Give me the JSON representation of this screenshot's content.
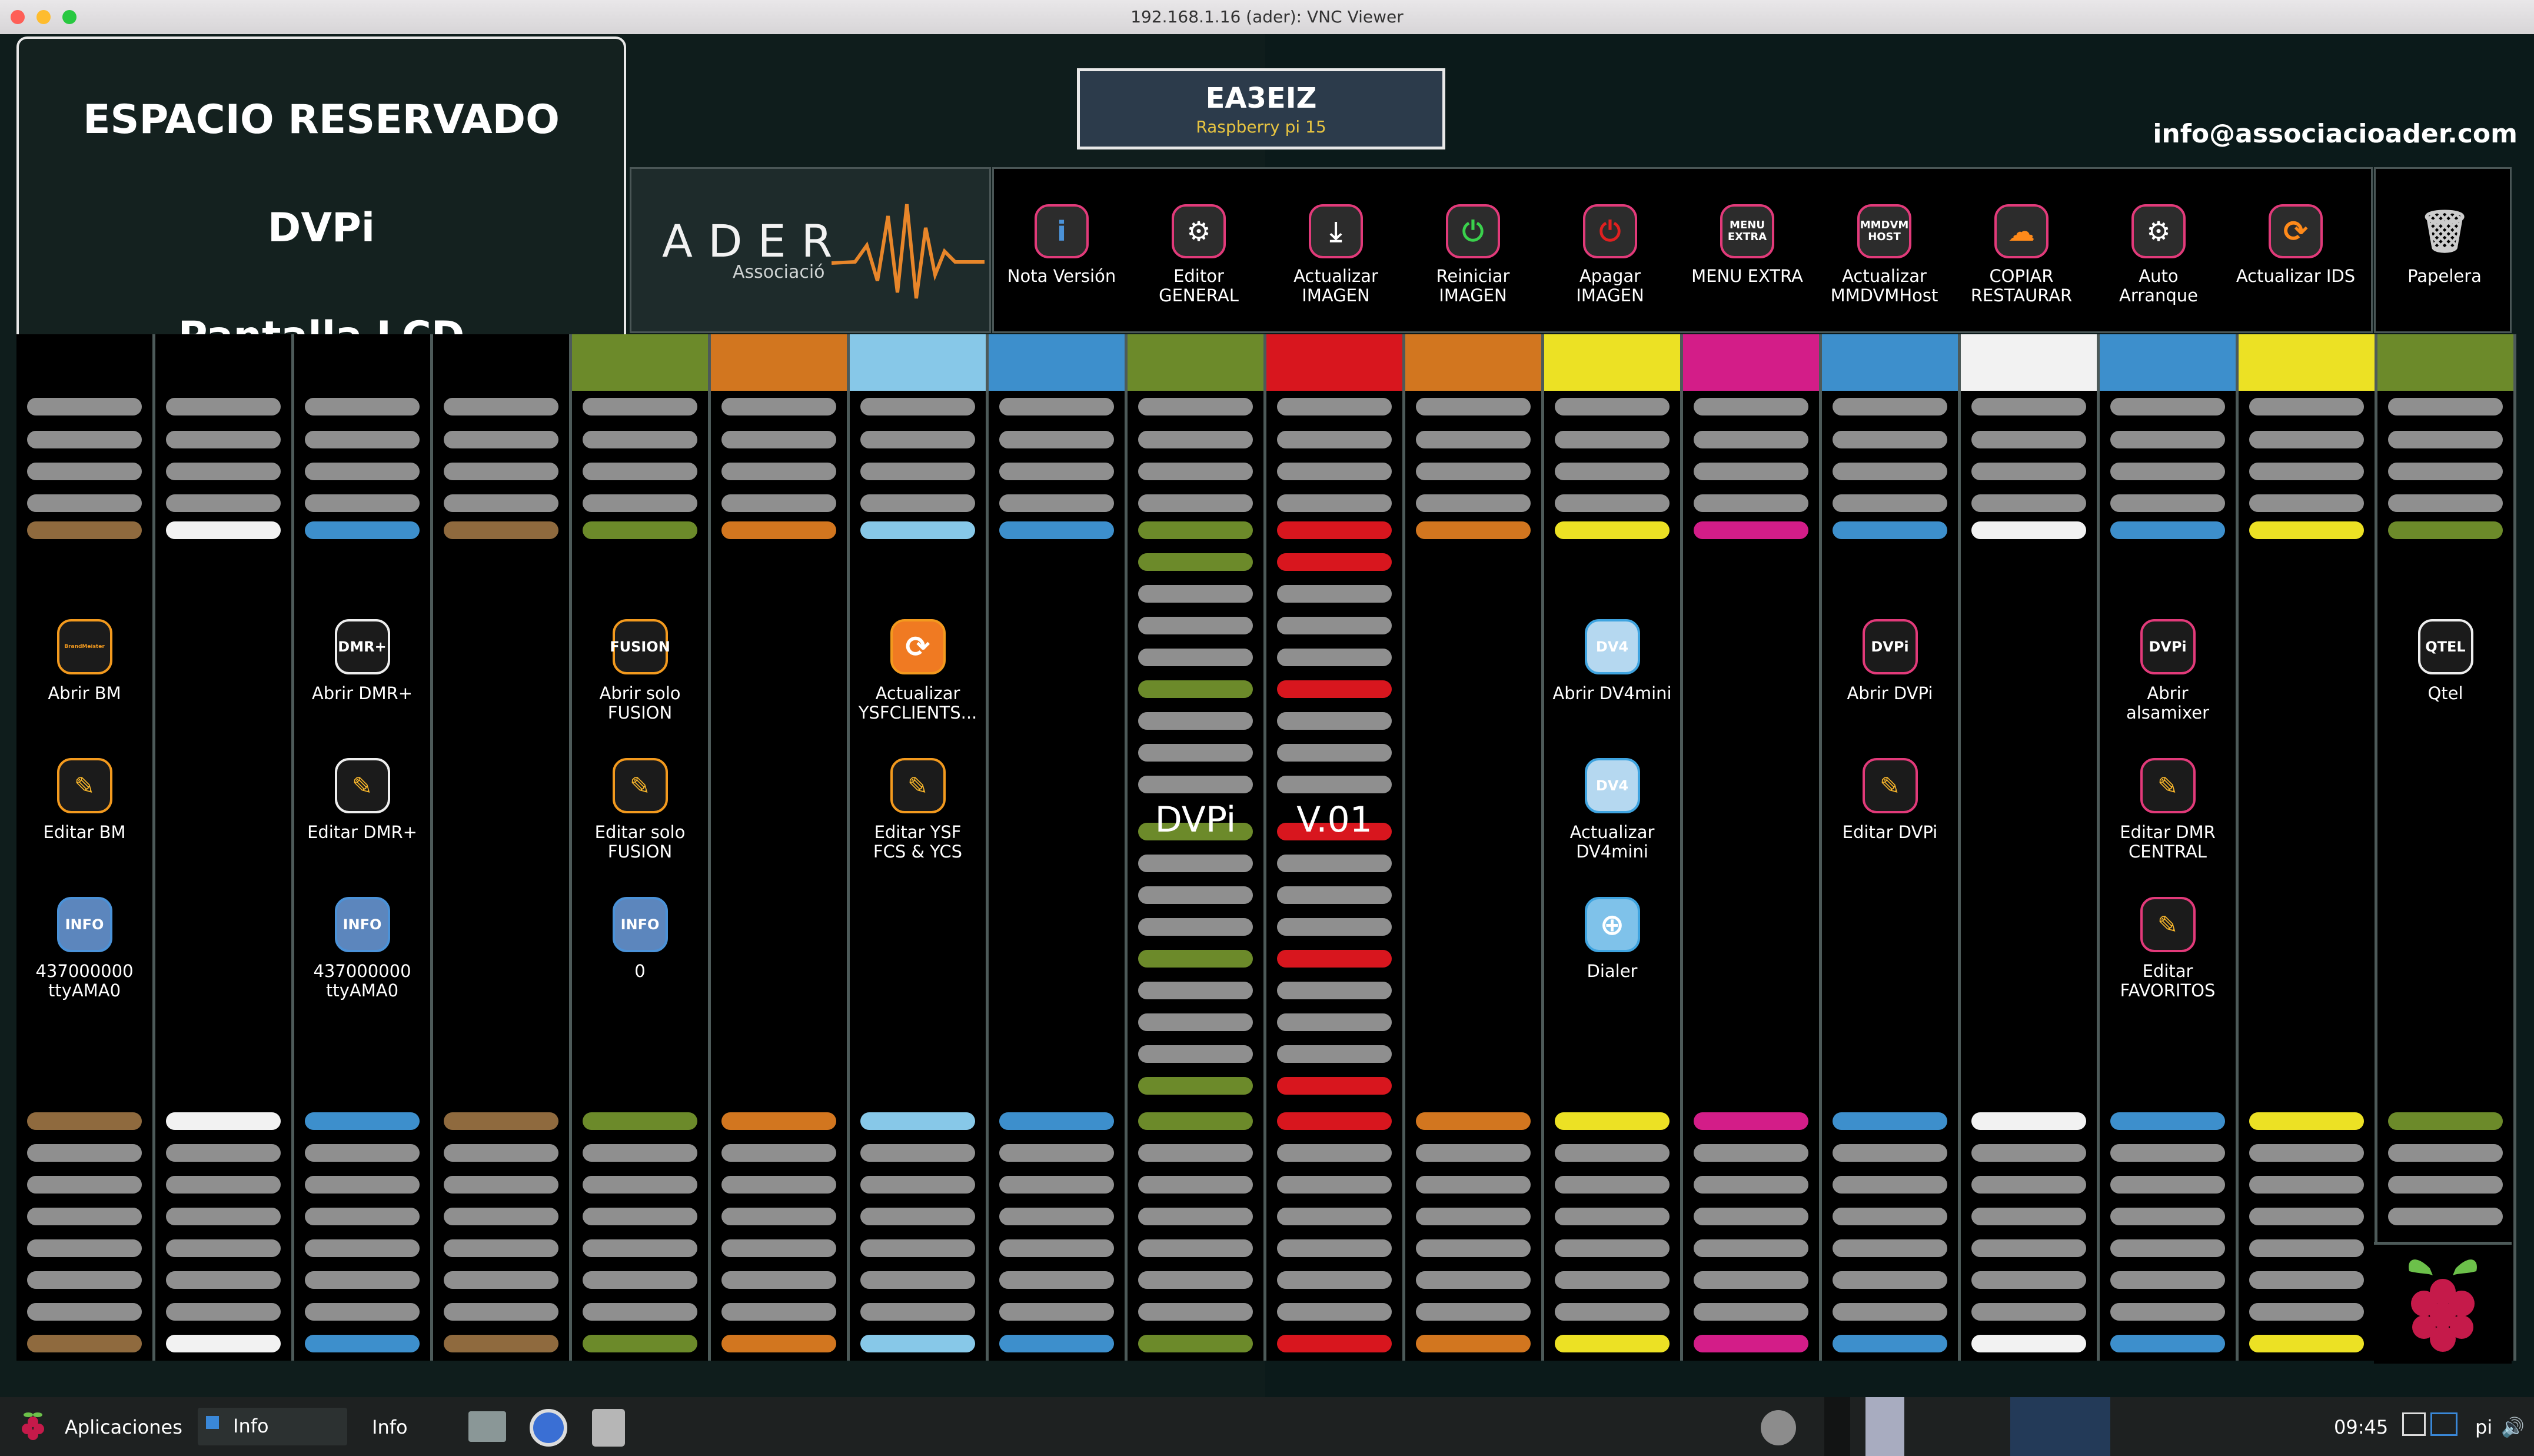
{
  "window": {
    "title": "192.168.1.16 (ader): VNC Viewer"
  },
  "reserved": {
    "line1": "ESPACIO RESERVADO",
    "line2": "DVPi",
    "line3": "Pantalla LCD"
  },
  "header": {
    "callsign": "EA3EIZ",
    "device": "Raspberry pi 15",
    "email": "info@associacioader.com"
  },
  "logo": {
    "name": "ADER",
    "subtitle": "Associació"
  },
  "toolbar": [
    {
      "label1": "Nota Versión",
      "label2": "",
      "icon": "info-icon",
      "glyph": "i"
    },
    {
      "label1": "Editor",
      "label2": "GENERAL",
      "icon": "editor-icon",
      "glyph": "⚙"
    },
    {
      "label1": "Actualizar",
      "label2": "IMAGEN",
      "icon": "download-icon",
      "glyph": "⤓"
    },
    {
      "label1": "Reiniciar",
      "label2": "IMAGEN",
      "icon": "power-icon",
      "glyph": "⏻"
    },
    {
      "label1": "Apagar",
      "label2": "IMAGEN",
      "icon": "shutdown-icon",
      "glyph": "⏻"
    },
    {
      "label1": "MENU EXTRA",
      "label2": "",
      "icon": "menu-extra-icon",
      "glyph": "MENU EXTRA"
    },
    {
      "label1": "Actualizar",
      "label2": "MMDVMHost",
      "icon": "mmdvm-icon",
      "glyph": "MMDVM HOST"
    },
    {
      "label1": "COPIAR",
      "label2": "RESTAURAR",
      "icon": "cloud-icon",
      "glyph": "☁"
    },
    {
      "label1": "Auto",
      "label2": "Arranque",
      "icon": "gear-icon",
      "glyph": "⚙"
    },
    {
      "label1": "Actualizar IDS",
      "label2": "",
      "icon": "refresh-icon",
      "glyph": "⟳"
    }
  ],
  "trash": {
    "label": "Papelera",
    "icon": "trash-icon"
  },
  "colors": {
    "brown": "#8f6a3e",
    "white": "#f2f2f2",
    "blue": "#3d8fcc",
    "olive": "#6c8a2a",
    "orange": "#d2761f",
    "skyblue": "#87c8e8",
    "red": "#d8161e",
    "yellow": "#ece124",
    "magenta": "#d31d88",
    "teal": "#2a5f70",
    "gray": "#8f8f8f"
  },
  "columns": {
    "c1": {
      "btn1": "Abrir BM",
      "btn2": "Editar BM",
      "btn3a": "437000000",
      "btn3b": "ttyAMA0"
    },
    "c3": {
      "btn1": "Abrir DMR+",
      "btn2": "Editar DMR+",
      "btn3a": "437000000",
      "btn3b": "ttyAMA0"
    },
    "c5": {
      "btn1a": "Abrir solo",
      "btn1b": "FUSION",
      "btn2a": "Editar solo",
      "btn2b": "FUSION",
      "btn3": "0"
    },
    "c7": {
      "btn1a": "Actualizar",
      "btn1b": "YSFCLIENTS...",
      "btn2a": "Editar YSF",
      "btn2b": "FCS & YCS"
    },
    "c9": {
      "big": "DVPi"
    },
    "c10": {
      "big": "V.01"
    },
    "c12": {
      "btn1": "Abrir DV4mini",
      "btn2a": "Actualizar",
      "btn2b": "DV4mini",
      "btn3": "Dialer"
    },
    "c14": {
      "btn1": "Abrir DVPi",
      "btn2": "Editar DVPi"
    },
    "c16": {
      "btn1a": "Abrir",
      "btn1b": "alsamixer",
      "btn2a": "Editar DMR",
      "btn2b": "CENTRAL",
      "btn3a": "Editar",
      "btn3b": "FAVORITOS"
    },
    "c18": {
      "btn1": "Qtel"
    }
  },
  "icon_text": {
    "dmr": "DMR+",
    "fusion": "FUSION",
    "info": "INFO",
    "dvpi": "DVPi",
    "dv4": "DV4",
    "qtel": "QTEL",
    "bm": "BrandMeister"
  },
  "taskbar": {
    "apps": "Aplicaciones",
    "task1": "Info",
    "task2": "Info",
    "time": "09:45",
    "user": "pi"
  }
}
